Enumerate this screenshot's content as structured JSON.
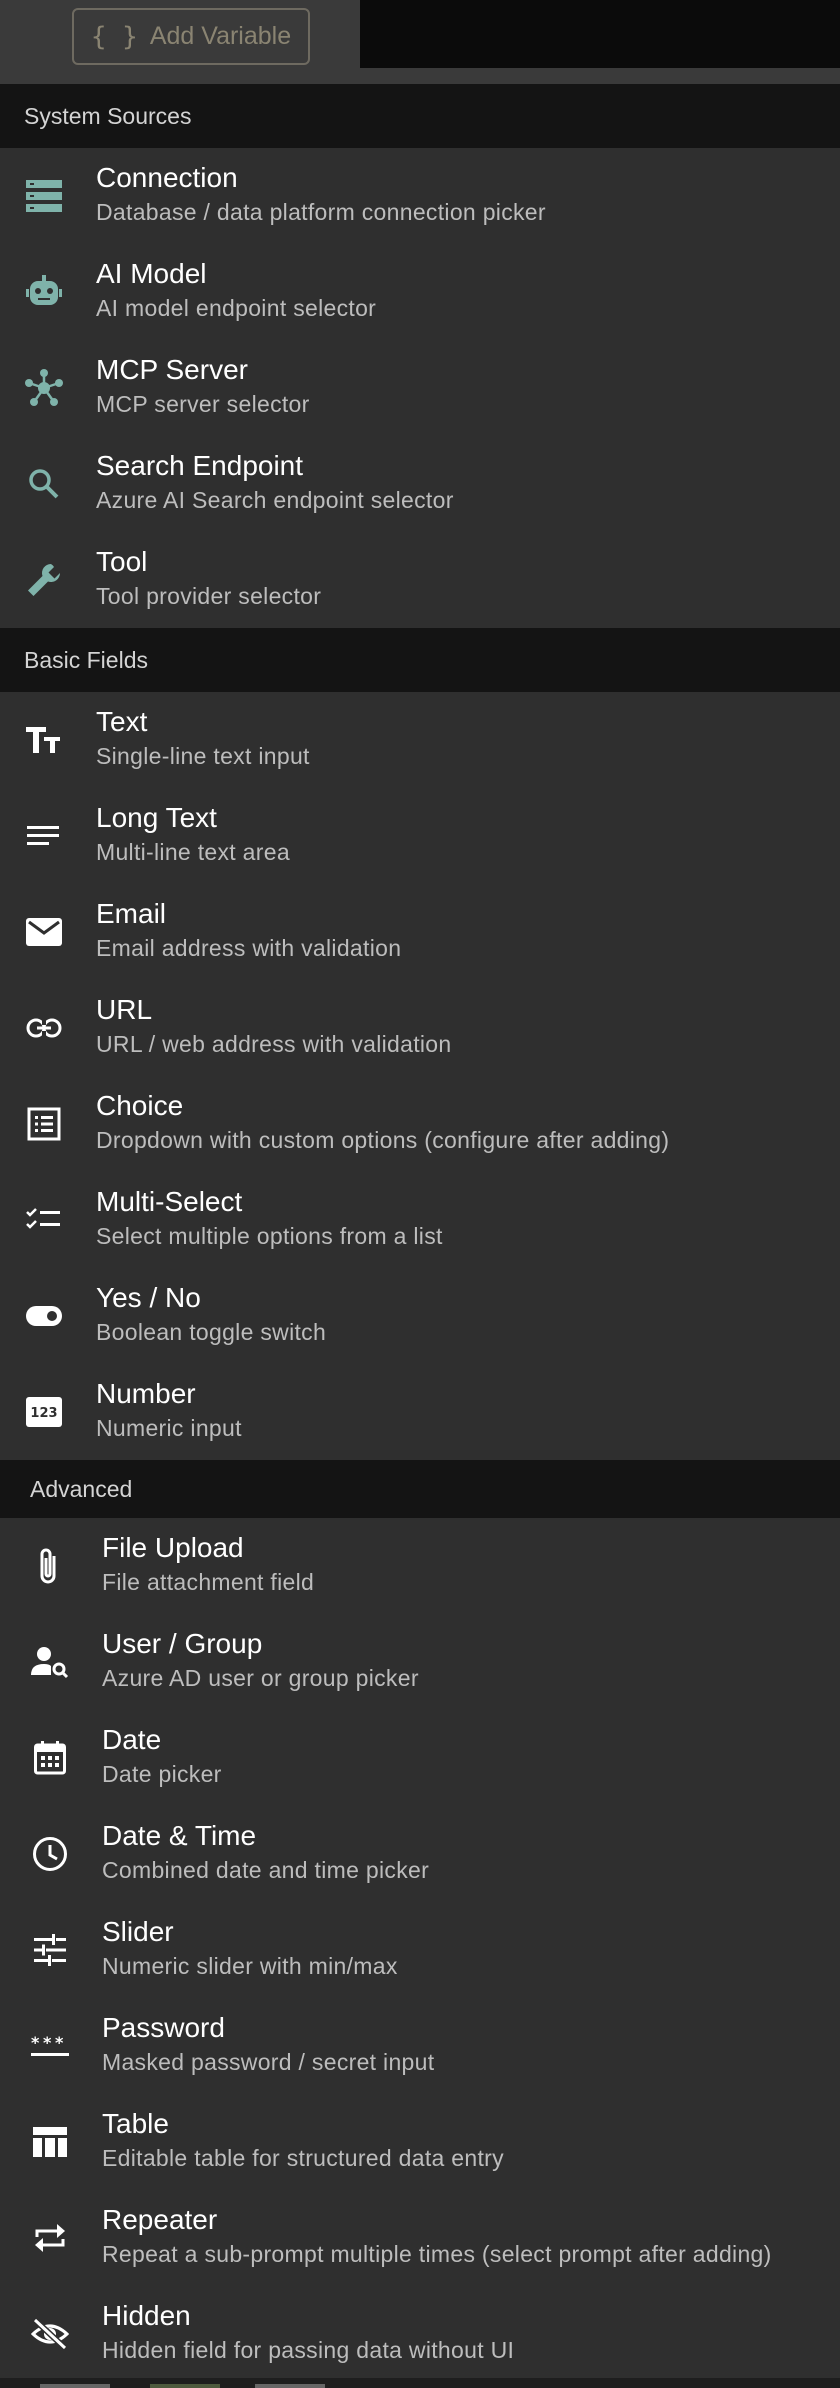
{
  "toolbar": {
    "add_variable_label": "Add Variable"
  },
  "sections": {
    "system": {
      "label": "System Sources",
      "items": [
        {
          "title": "Connection",
          "desc": "Database / data platform connection picker",
          "icon": "database-icon"
        },
        {
          "title": "AI Model",
          "desc": "AI model endpoint selector",
          "icon": "robot-icon"
        },
        {
          "title": "MCP Server",
          "desc": "MCP server selector",
          "icon": "hub-icon"
        },
        {
          "title": "Search Endpoint",
          "desc": "Azure AI Search endpoint selector",
          "icon": "search-icon"
        },
        {
          "title": "Tool",
          "desc": "Tool provider selector",
          "icon": "wrench-icon"
        }
      ]
    },
    "basic": {
      "label": "Basic Fields",
      "items": [
        {
          "title": "Text",
          "desc": "Single-line text input",
          "icon": "text-icon"
        },
        {
          "title": "Long Text",
          "desc": "Multi-line text area",
          "icon": "lines-icon"
        },
        {
          "title": "Email",
          "desc": "Email address with validation",
          "icon": "mail-icon"
        },
        {
          "title": "URL",
          "desc": "URL / web address with validation",
          "icon": "link-icon"
        },
        {
          "title": "Choice",
          "desc": "Dropdown with custom options (configure after adding)",
          "icon": "list-icon"
        },
        {
          "title": "Multi-Select",
          "desc": "Select multiple options from a list",
          "icon": "checklist-icon"
        },
        {
          "title": "Yes / No",
          "desc": "Boolean toggle switch",
          "icon": "toggle-icon"
        },
        {
          "title": "Number",
          "desc": "Numeric input",
          "icon": "number-icon"
        }
      ]
    },
    "advanced": {
      "label": "Advanced",
      "items": [
        {
          "title": "File Upload",
          "desc": "File attachment field",
          "icon": "paperclip-icon"
        },
        {
          "title": "User / Group",
          "desc": "Azure AD user or group picker",
          "icon": "user-search-icon"
        },
        {
          "title": "Date",
          "desc": "Date picker",
          "icon": "calendar-icon"
        },
        {
          "title": "Date & Time",
          "desc": "Combined date and time picker",
          "icon": "clock-icon"
        },
        {
          "title": "Slider",
          "desc": "Numeric slider with min/max",
          "icon": "sliders-icon"
        },
        {
          "title": "Password",
          "desc": "Masked password / secret input",
          "icon": "password-icon"
        },
        {
          "title": "Table",
          "desc": "Editable table for structured data entry",
          "icon": "table-icon"
        },
        {
          "title": "Repeater",
          "desc": "Repeat a sub-prompt multiple times (select prompt after adding)",
          "icon": "repeat-icon"
        },
        {
          "title": "Hidden",
          "desc": "Hidden field for passing data without UI",
          "icon": "eye-off-icon"
        }
      ]
    }
  }
}
